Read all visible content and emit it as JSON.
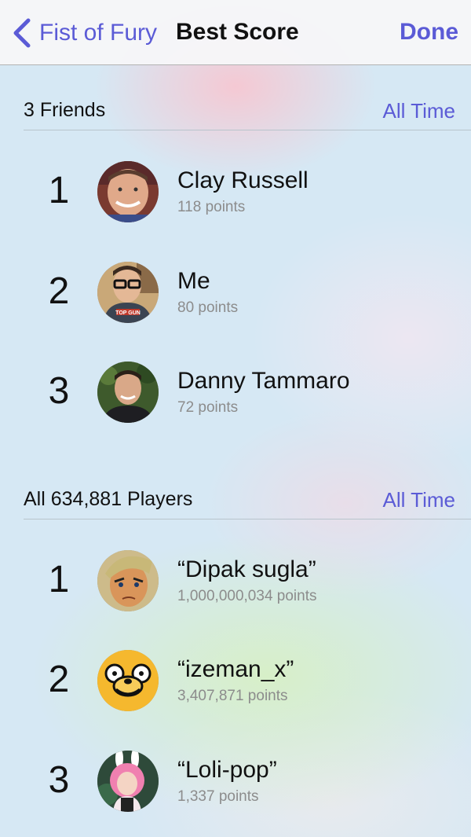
{
  "navbar": {
    "back_label": "Fist of Fury",
    "title": "Best Score",
    "done_label": "Done"
  },
  "friends": {
    "title": "3 Friends",
    "filter": "All Time",
    "rows": [
      {
        "rank": "1",
        "name": "Clay Russell",
        "points": "118 points"
      },
      {
        "rank": "2",
        "name": "Me",
        "points": "80 points"
      },
      {
        "rank": "3",
        "name": "Danny Tammaro",
        "points": "72 points"
      }
    ]
  },
  "all_players": {
    "title": "All 634,881 Players",
    "filter": "All Time",
    "rows": [
      {
        "rank": "1",
        "name": "“Dipak sugla”",
        "points": "1,000,000,034 points"
      },
      {
        "rank": "2",
        "name": "“izeman_x”",
        "points": "3,407,871 points"
      },
      {
        "rank": "3",
        "name": "“Loli-pop”",
        "points": "1,337 points"
      }
    ]
  },
  "avatar_shirt_text": "TOP GUN",
  "colors": {
    "accent": "#5b5bd6",
    "background": "#d6e8f4"
  }
}
